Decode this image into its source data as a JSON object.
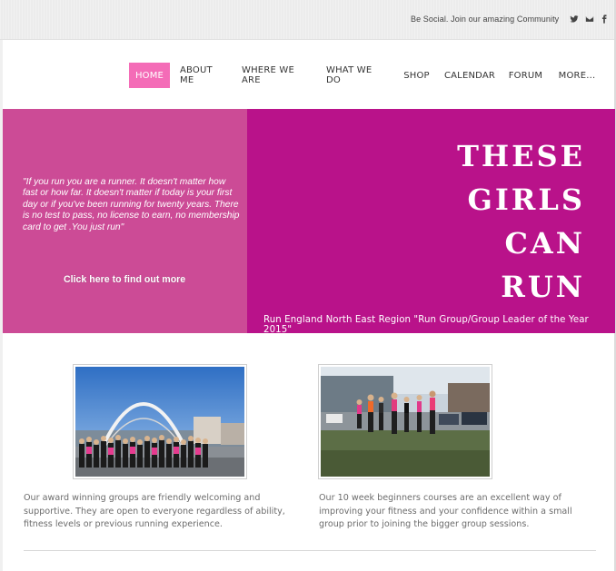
{
  "header": {
    "social_text": "Be Social. Join our amazing Community",
    "icons": [
      "twitter-icon",
      "email-icon",
      "facebook-icon"
    ]
  },
  "nav": {
    "items": [
      {
        "label": "HOME",
        "active": true
      },
      {
        "label": "ABOUT ME",
        "active": false
      },
      {
        "label": "WHERE WE ARE",
        "active": false
      },
      {
        "label": "WHAT WE DO",
        "active": false
      },
      {
        "label": "SHOP",
        "active": false
      },
      {
        "label": "CALENDAR",
        "active": false
      },
      {
        "label": "FORUM",
        "active": false
      },
      {
        "label": "MORE...",
        "active": false
      }
    ],
    "active_color": "#f46cb7"
  },
  "hero": {
    "quote": "\"If you run you are a runner. It doesn't matter how fast or how far. It doesn't matter if today is your first day or if you've been running for twenty years. There is no test to pass, no license to earn, no membership card to get .You just run\"",
    "cta": "Click here to find out more",
    "slogan_lines": [
      "THESE",
      "GIRLS",
      "CAN",
      "RUN"
    ],
    "award": "Run England North East Region \"Run Group/Group Leader of the Year 2015\"",
    "left_color": "#cc4b96",
    "right_color": "#b9128a"
  },
  "features": [
    {
      "caption": "Our award winning groups are friendly welcoming and supportive. They are open to everyone regardless of ability, fitness levels or previous running experience."
    },
    {
      "caption": "Our 10 week beginners courses are an excellent way of improving your fitness and your confidence within a small group prior to joining the bigger group sessions."
    }
  ]
}
